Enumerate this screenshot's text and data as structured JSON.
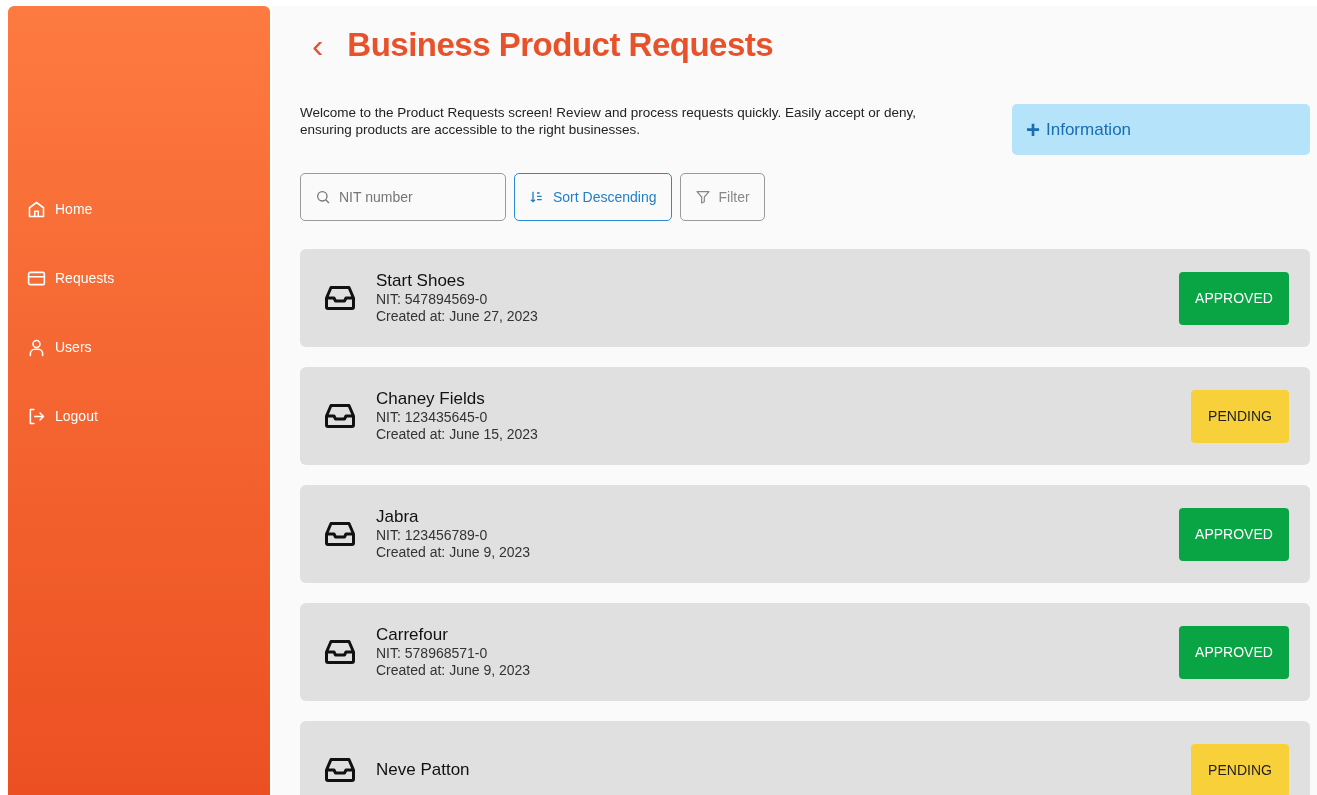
{
  "sidebar": {
    "items": [
      {
        "label": "Home"
      },
      {
        "label": "Requests"
      },
      {
        "label": "Users"
      },
      {
        "label": "Logout"
      }
    ]
  },
  "header": {
    "back": "‹",
    "title": "Business Product Requests"
  },
  "intro": "Welcome to the Product Requests screen! Review and process requests quickly. Easily accept or deny, ensuring products are accessible to the right businesses.",
  "info_button": {
    "icon": "+",
    "label": "Information"
  },
  "toolbar": {
    "search": {
      "placeholder": "NIT number"
    },
    "sort_button": "Sort Descending",
    "filter_button": "Filter"
  },
  "requests": [
    {
      "name": "Start Shoes",
      "nit": "NIT: 547894569-0",
      "created": "Created at: June 27, 2023",
      "kind": "approved",
      "status_label": "APPROVED"
    },
    {
      "name": "Chaney Fields",
      "nit": "NIT: 123435645-0",
      "created": "Created at: June 15, 2023",
      "kind": "pending",
      "status_label": "PENDING"
    },
    {
      "name": "Jabra",
      "nit": "NIT: 123456789-0",
      "created": "Created at: June 9, 2023",
      "kind": "approved",
      "status_label": "APPROVED"
    },
    {
      "name": "Carrefour",
      "nit": "NIT: 578968571-0",
      "created": "Created at: June 9, 2023",
      "kind": "approved",
      "status_label": "APPROVED"
    },
    {
      "name": "Neve Patton",
      "kind": "pending",
      "status_label": "PENDING"
    }
  ]
}
